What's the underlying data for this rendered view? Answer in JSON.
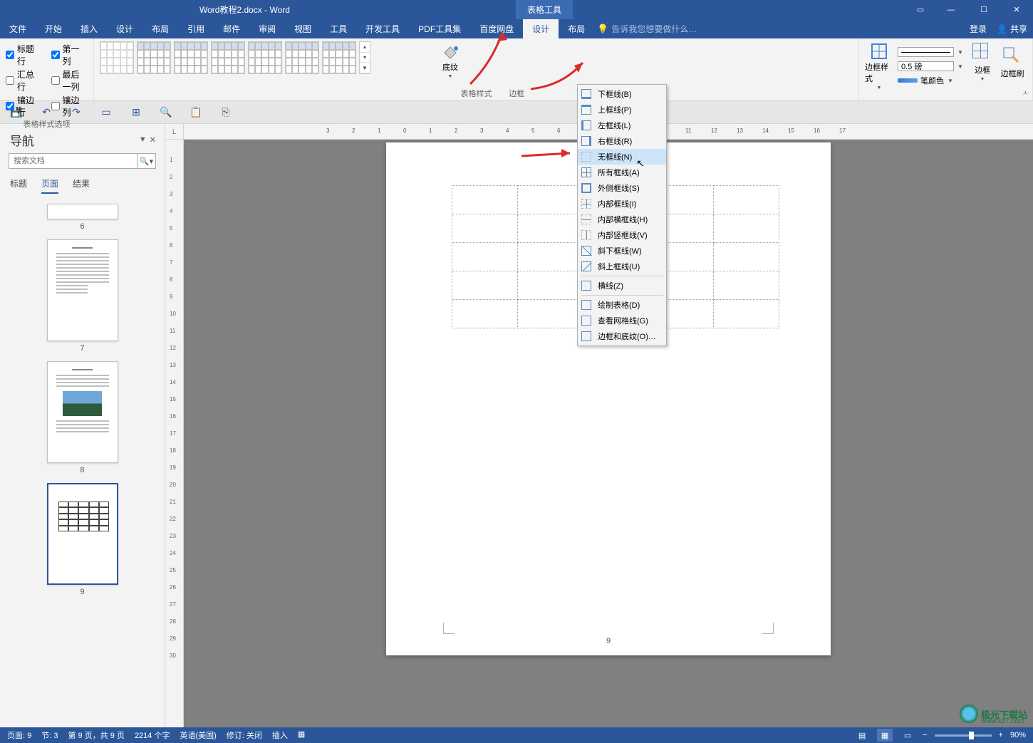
{
  "title": "Word教程2.docx - Word",
  "context_tab": "表格工具",
  "menus": [
    "文件",
    "开始",
    "插入",
    "设计",
    "布局",
    "引用",
    "邮件",
    "审阅",
    "视图",
    "工具",
    "开发工具",
    "PDF工具集",
    "百度网盘",
    "设计",
    "布局"
  ],
  "active_menu_index": 13,
  "tell_me": "告诉我您想要做什么…",
  "login": "登录",
  "share": "共享",
  "ribbon": {
    "group_styleopts": "表格样式选项",
    "group_styles": "表格样式",
    "group_borders": "边框",
    "chk_header": "标题行",
    "chk_firstcol": "第一列",
    "chk_total": "汇总行",
    "chk_lastcol": "最后一列",
    "chk_banded": "镶边行",
    "chk_bandedcol": "镶边列",
    "shading": "底纹",
    "border_styles": "边框样式",
    "line_weight": "0.5 磅",
    "pen_color": "笔颜色",
    "borders_btn": "边框",
    "border_painter": "边框刷"
  },
  "nav": {
    "title": "导航",
    "search_ph": "搜索文档",
    "tabs": [
      "标题",
      "页面",
      "结果"
    ],
    "active_tab": 1,
    "pages": [
      "6",
      "7",
      "8",
      "9"
    ],
    "selected": 3
  },
  "dropdown": {
    "items": [
      {
        "label": "下框线(B)",
        "ico": "bottom"
      },
      {
        "label": "上框线(P)",
        "ico": "top"
      },
      {
        "label": "左框线(L)",
        "ico": "left"
      },
      {
        "label": "右框线(R)",
        "ico": "right"
      },
      {
        "label": "无框线(N)",
        "ico": "none",
        "hover": true
      },
      {
        "label": "所有框线(A)",
        "ico": "all"
      },
      {
        "label": "外侧框线(S)",
        "ico": "outer"
      },
      {
        "label": "内部框线(I)",
        "ico": "inner"
      },
      {
        "label": "内部横框线(H)",
        "ico": "innerh"
      },
      {
        "label": "内部竖框线(V)",
        "ico": "innerv"
      },
      {
        "label": "斜下框线(W)",
        "ico": "diagd"
      },
      {
        "label": "斜上框线(U)",
        "ico": "diagu"
      },
      {
        "sep": true
      },
      {
        "label": "横线(Z)",
        "ico": "hline"
      },
      {
        "sep": true
      },
      {
        "label": "绘制表格(D)",
        "ico": "draw"
      },
      {
        "label": "查看网格线(G)",
        "ico": "grid"
      },
      {
        "label": "边框和底纹(O)…",
        "ico": "dlg"
      }
    ]
  },
  "doc_page_number": "9",
  "status": {
    "page": "页面: 9",
    "section": "节: 3",
    "pageof": "第 9 页，共 9 页",
    "words": "2214 个字",
    "lang": "英语(美国)",
    "track": "修订: 关闭",
    "mode": "插入",
    "zoom": "90%"
  },
  "watermark": {
    "main": "极光下载站",
    "sub": "www.xz7.com"
  }
}
